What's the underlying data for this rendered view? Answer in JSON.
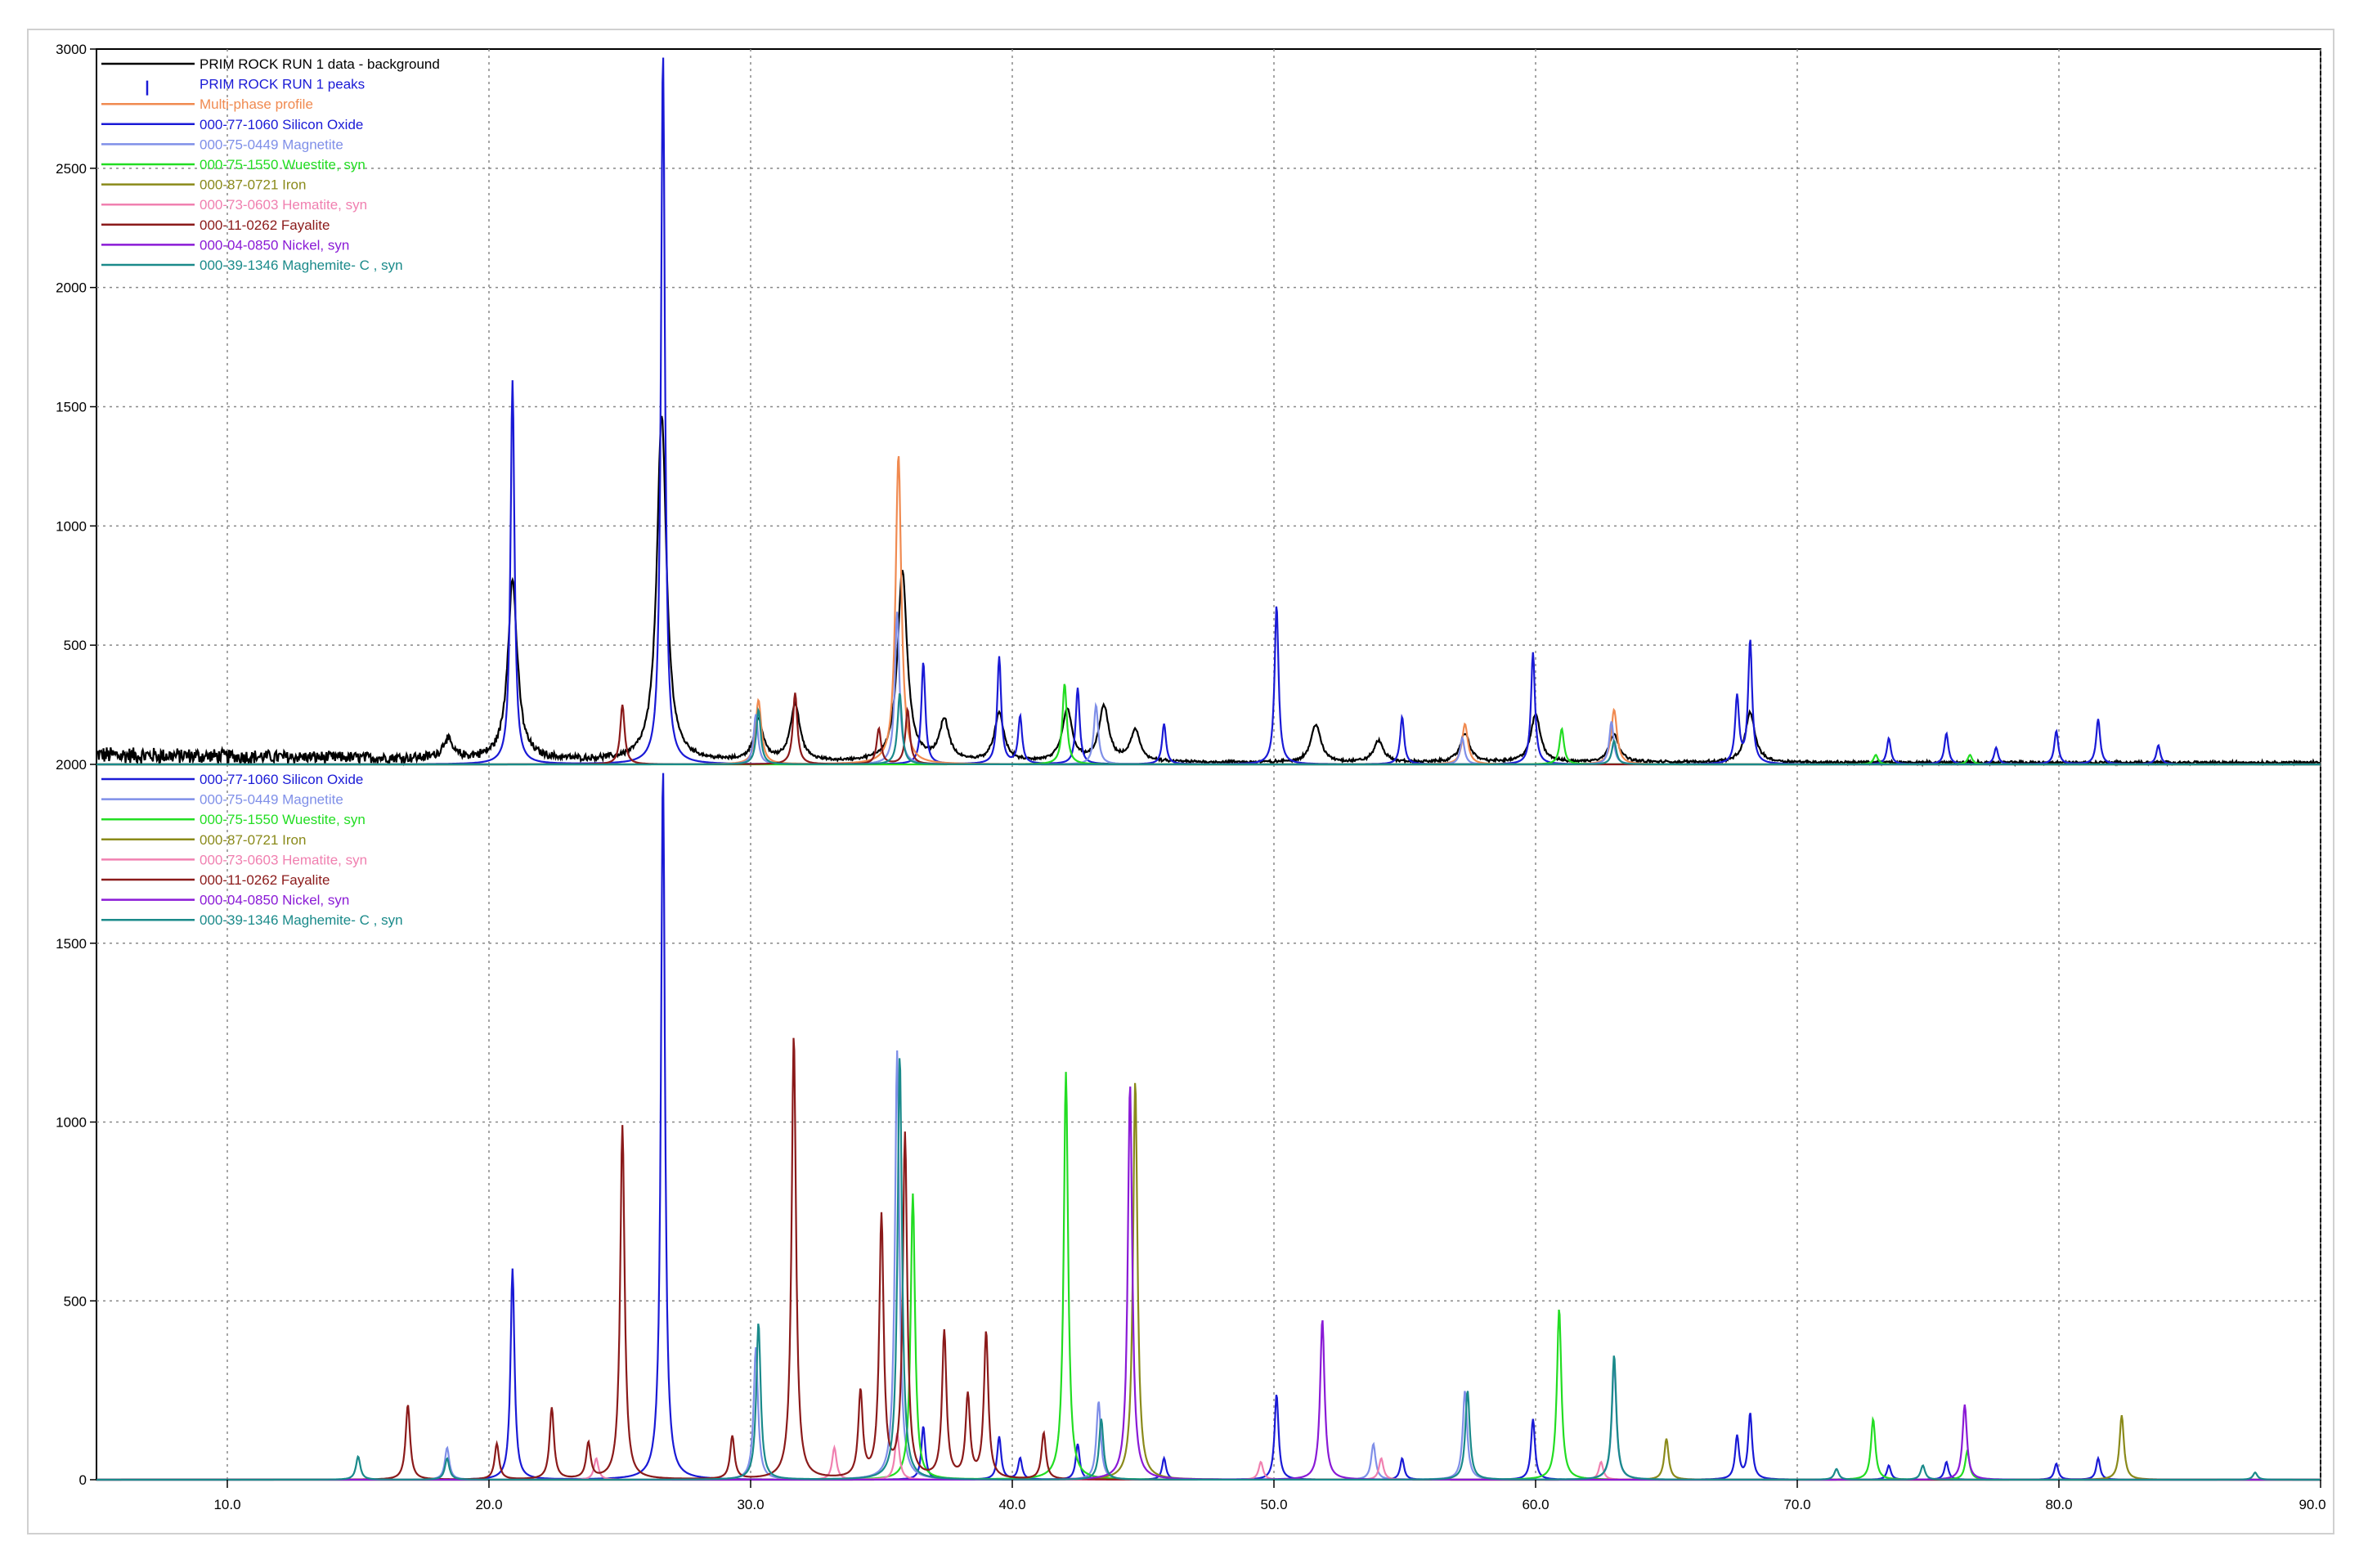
{
  "chart_data": [
    {
      "type": "line",
      "panel": "top",
      "xlim": [
        5,
        90
      ],
      "ylim": [
        0,
        3000
      ],
      "y_tick_labels": [
        "3000",
        "2500",
        "2000",
        "1500",
        "1000",
        "500",
        "2000"
      ],
      "y_tick_values": [
        3000,
        2500,
        2000,
        1500,
        1000,
        500,
        0
      ],
      "grid": true,
      "legend_position": "top-left",
      "legend": [
        {
          "name": "PRIM ROCK RUN 1 data - background",
          "color": "#000000",
          "marker": "line"
        },
        {
          "name": "PRIM ROCK RUN 1 peaks",
          "color": "#1a1ad6",
          "marker": "bar"
        },
        {
          "name": "Multi-phase profile",
          "color": "#f08a50",
          "marker": "line"
        },
        {
          "name": "000-77-1060 Silicon Oxide",
          "color": "#1a1ad6",
          "marker": "line"
        },
        {
          "name": "000-75-0449 Magnetite",
          "color": "#7f8fe8",
          "marker": "line"
        },
        {
          "name": "000-75-1550 Wuestite, syn",
          "color": "#22dd22",
          "marker": "line"
        },
        {
          "name": "000-87-0721 Iron",
          "color": "#8a8a1a",
          "marker": "line"
        },
        {
          "name": "000-73-0603 Hematite, syn",
          "color": "#f080b0",
          "marker": "line"
        },
        {
          "name": "000-11-0262 Fayalite",
          "color": "#8b1a1a",
          "marker": "line"
        },
        {
          "name": "000-04-0850 Nickel, syn",
          "color": "#8a1ad6",
          "marker": "line"
        },
        {
          "name": "000-39-1346 Maghemite- C , syn",
          "color": "#1a8a8a",
          "marker": "line"
        }
      ],
      "series": [
        {
          "name": "PRIM ROCK RUN 1 data - background",
          "color": "#000000",
          "peaks": [
            [
              18.4,
              80
            ],
            [
              20.9,
              750
            ],
            [
              26.6,
              1450
            ],
            [
              30.3,
              170
            ],
            [
              31.7,
              240
            ],
            [
              35.8,
              800
            ],
            [
              37.4,
              170
            ],
            [
              39.5,
              200
            ],
            [
              42.1,
              220
            ],
            [
              43.5,
              230
            ],
            [
              44.7,
              130
            ],
            [
              51.6,
              160
            ],
            [
              54.0,
              90
            ],
            [
              57.3,
              120
            ],
            [
              60.0,
              200
            ],
            [
              63.0,
              120
            ],
            [
              68.2,
              210
            ]
          ],
          "width": 0.22,
          "noise_level": 25
        },
        {
          "name": "000-77-1060 Silicon Oxide",
          "color": "#1a1ad6",
          "peaks": [
            [
              20.9,
              1610
            ],
            [
              26.65,
              3000
            ],
            [
              36.6,
              430
            ],
            [
              39.5,
              450
            ],
            [
              40.3,
              200
            ],
            [
              42.5,
              320
            ],
            [
              45.8,
              170
            ],
            [
              50.1,
              670
            ],
            [
              54.9,
              200
            ],
            [
              59.9,
              470
            ],
            [
              67.7,
              280
            ],
            [
              68.2,
              520
            ],
            [
              73.5,
              110
            ],
            [
              75.7,
              130
            ],
            [
              77.6,
              70
            ],
            [
              79.9,
              140
            ],
            [
              81.5,
              190
            ],
            [
              83.8,
              80
            ]
          ],
          "width": 0.09
        },
        {
          "name": "Multi-phase profile",
          "color": "#f08a50",
          "peaks": [
            [
              35.65,
              1300
            ],
            [
              30.3,
              270
            ],
            [
              57.3,
              170
            ],
            [
              63.0,
              230
            ]
          ],
          "width": 0.13
        },
        {
          "name": "000-75-0449 Magnetite",
          "color": "#7f8fe8",
          "peaks": [
            [
              30.2,
              210
            ],
            [
              35.6,
              640
            ],
            [
              43.2,
              250
            ],
            [
              57.2,
              110
            ],
            [
              62.9,
              180
            ]
          ],
          "width": 0.1
        },
        {
          "name": "000-75-1550 Wuestite, syn",
          "color": "#22dd22",
          "peaks": [
            [
              42.0,
              340
            ],
            [
              61.0,
              150
            ],
            [
              73.0,
              40
            ],
            [
              76.6,
              40
            ]
          ],
          "width": 0.1
        },
        {
          "name": "000-11-0262 Fayalite",
          "color": "#8b1a1a",
          "peaks": [
            [
              25.1,
              250
            ],
            [
              31.7,
              300
            ],
            [
              34.9,
              150
            ],
            [
              36.0,
              230
            ]
          ],
          "width": 0.1
        },
        {
          "name": "000-39-1346 Maghemite- C , syn",
          "color": "#1a8a8a",
          "peaks": [
            [
              30.3,
              230
            ],
            [
              35.7,
              300
            ],
            [
              63.0,
              100
            ]
          ],
          "width": 0.1
        }
      ]
    },
    {
      "type": "line",
      "panel": "bottom",
      "xlim": [
        5,
        90
      ],
      "ylim": [
        0,
        2000
      ],
      "y_tick_labels": [
        "1500",
        "1000",
        "500",
        "0"
      ],
      "y_tick_values": [
        1500,
        1000,
        500,
        0
      ],
      "x_tick_labels": [
        "10.0",
        "20.0",
        "30.0",
        "40.0",
        "50.0",
        "60.0",
        "70.0",
        "80.0",
        "90.0"
      ],
      "x_tick_values": [
        10,
        20,
        30,
        40,
        50,
        60,
        70,
        80,
        90
      ],
      "grid": true,
      "legend_position": "top-left",
      "legend": [
        {
          "name": "000-77-1060 Silicon Oxide",
          "color": "#1a1ad6"
        },
        {
          "name": "000-75-0449 Magnetite",
          "color": "#7f8fe8"
        },
        {
          "name": "000-75-1550 Wuestite, syn",
          "color": "#22dd22"
        },
        {
          "name": "000-87-0721 Iron",
          "color": "#8a8a1a"
        },
        {
          "name": "000-73-0603 Hematite, syn",
          "color": "#f080b0"
        },
        {
          "name": "000-11-0262 Fayalite",
          "color": "#8b1a1a"
        },
        {
          "name": "000-04-0850 Nickel, syn",
          "color": "#8a1ad6"
        },
        {
          "name": "000-39-1346 Maghemite- C , syn",
          "color": "#1a8a8a"
        }
      ],
      "series": [
        {
          "name": "000-77-1060 Silicon Oxide",
          "color": "#1a1ad6",
          "peaks": [
            [
              20.9,
              590
            ],
            [
              26.65,
              2000
            ],
            [
              36.6,
              150
            ],
            [
              39.5,
              120
            ],
            [
              40.3,
              60
            ],
            [
              42.5,
              100
            ],
            [
              45.8,
              60
            ],
            [
              50.1,
              240
            ],
            [
              54.9,
              60
            ],
            [
              59.9,
              170
            ],
            [
              67.7,
              120
            ],
            [
              68.2,
              185
            ],
            [
              73.5,
              40
            ],
            [
              75.7,
              50
            ],
            [
              79.9,
              45
            ],
            [
              81.5,
              60
            ]
          ],
          "width": 0.09
        },
        {
          "name": "000-75-0449 Magnetite",
          "color": "#7f8fe8",
          "peaks": [
            [
              18.4,
              90
            ],
            [
              30.2,
              370
            ],
            [
              35.6,
              1200
            ],
            [
              43.3,
              220
            ],
            [
              53.8,
              100
            ],
            [
              57.3,
              250
            ],
            [
              63.0,
              330
            ]
          ],
          "width": 0.1
        },
        {
          "name": "000-75-1550 Wuestite, syn",
          "color": "#22dd22",
          "peaks": [
            [
              36.2,
              800
            ],
            [
              42.05,
              1140
            ],
            [
              60.9,
              480
            ],
            [
              72.9,
              170
            ],
            [
              76.5,
              80
            ]
          ],
          "width": 0.1
        },
        {
          "name": "000-87-0721 Iron",
          "color": "#8a8a1a",
          "peaks": [
            [
              44.7,
              1120
            ],
            [
              65.0,
              115
            ],
            [
              82.4,
              180
            ]
          ],
          "width": 0.1
        },
        {
          "name": "000-73-0603 Hematite, syn",
          "color": "#f080b0",
          "peaks": [
            [
              24.1,
              60
            ],
            [
              33.2,
              90
            ],
            [
              35.6,
              130
            ],
            [
              49.5,
              50
            ],
            [
              54.1,
              60
            ],
            [
              62.5,
              50
            ]
          ],
          "width": 0.1
        },
        {
          "name": "000-11-0262 Fayalite",
          "color": "#8b1a1a",
          "peaks": [
            [
              16.9,
              210
            ],
            [
              20.3,
              100
            ],
            [
              22.4,
              200
            ],
            [
              23.8,
              100
            ],
            [
              25.1,
              990
            ],
            [
              29.3,
              120
            ],
            [
              31.65,
              1245
            ],
            [
              34.2,
              240
            ],
            [
              35.0,
              730
            ],
            [
              35.9,
              960
            ],
            [
              37.4,
              410
            ],
            [
              38.3,
              230
            ],
            [
              39.0,
              410
            ],
            [
              41.2,
              130
            ]
          ],
          "width": 0.1
        },
        {
          "name": "000-04-0850 Nickel, syn",
          "color": "#8a1ad6",
          "peaks": [
            [
              44.5,
              1110
            ],
            [
              51.85,
              450
            ],
            [
              76.4,
              210
            ]
          ],
          "width": 0.1
        },
        {
          "name": "000-39-1346 Maghemite- C , syn",
          "color": "#1a8a8a",
          "peaks": [
            [
              15.0,
              65
            ],
            [
              18.4,
              60
            ],
            [
              30.3,
              440
            ],
            [
              35.7,
              1190
            ],
            [
              43.4,
              170
            ],
            [
              57.4,
              250
            ],
            [
              63.0,
              350
            ],
            [
              71.5,
              30
            ],
            [
              74.8,
              40
            ],
            [
              87.5,
              20
            ]
          ],
          "width": 0.1
        }
      ]
    }
  ]
}
